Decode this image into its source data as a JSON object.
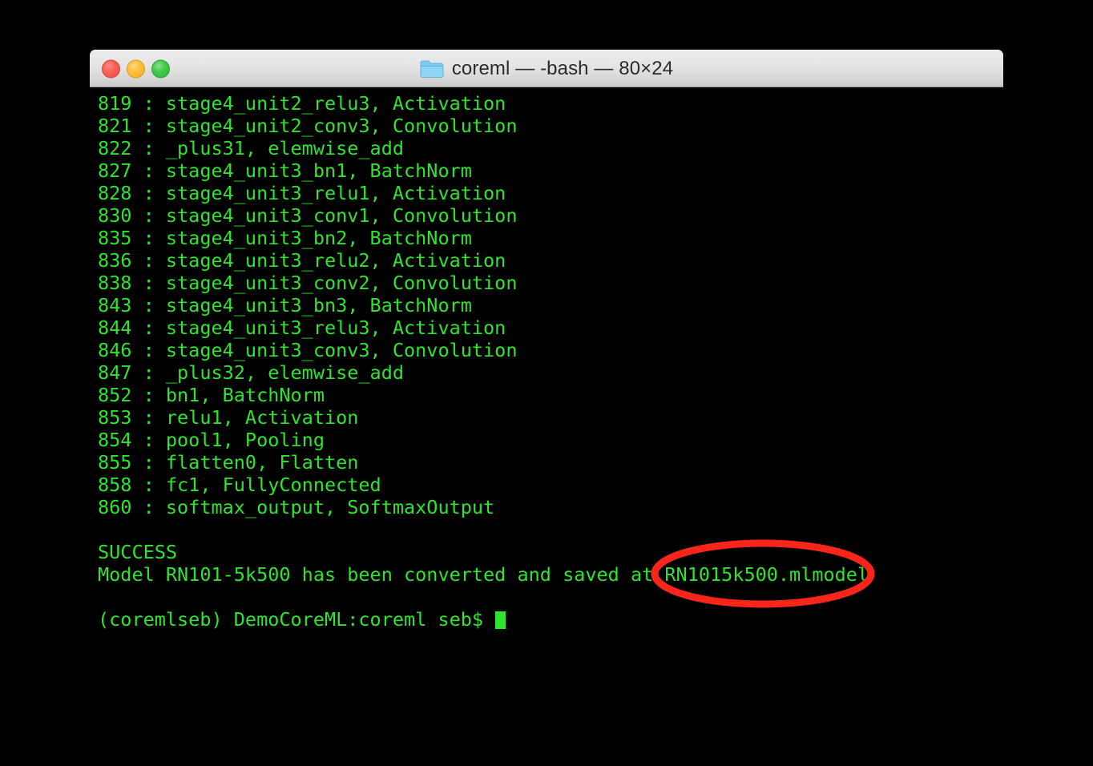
{
  "window": {
    "title": "coreml — -bash — 80×24",
    "folder_icon": "folder-icon",
    "controls": {
      "close_label": "close",
      "minimize_label": "minimize",
      "zoom_label": "zoom"
    }
  },
  "terminal": {
    "text_color": "#2fe32f",
    "background_color": "#000000",
    "cursor": "block-cursor",
    "lines": [
      "819 : stage4_unit2_relu3, Activation",
      "821 : stage4_unit2_conv3, Convolution",
      "822 : _plus31, elemwise_add",
      "827 : stage4_unit3_bn1, BatchNorm",
      "828 : stage4_unit3_relu1, Activation",
      "830 : stage4_unit3_conv1, Convolution",
      "835 : stage4_unit3_bn2, BatchNorm",
      "836 : stage4_unit3_relu2, Activation",
      "838 : stage4_unit3_conv2, Convolution",
      "843 : stage4_unit3_bn3, BatchNorm",
      "844 : stage4_unit3_relu3, Activation",
      "846 : stage4_unit3_conv3, Convolution",
      "847 : _plus32, elemwise_add",
      "852 : bn1, BatchNorm",
      "853 : relu1, Activation",
      "854 : pool1, Pooling",
      "855 : flatten0, Flatten",
      "858 : fc1, FullyConnected",
      "860 : softmax_output, SoftmaxOutput",
      "",
      "SUCCESS",
      "Model RN101-5k500 has been converted and saved at RN1015k500.mlmodel",
      "",
      "(coremlseb) DemoCoreML:coreml seb$ "
    ],
    "prompt": "(coremlseb) DemoCoreML:coreml seb$ ",
    "highlighted_text": "RN1015k500.mlmodel"
  },
  "annotation": {
    "shape": "ellipse",
    "color": "#f8251a",
    "stroke_width": 9,
    "targets_text": "RN1015k500.mlmodel"
  }
}
